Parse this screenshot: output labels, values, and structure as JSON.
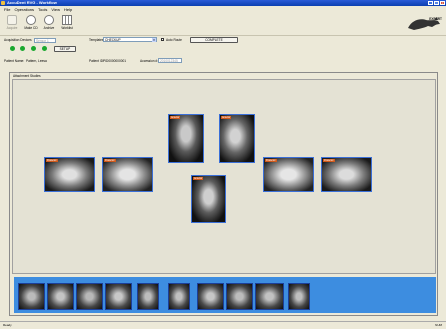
{
  "window": {
    "title": "AccuDent RVG - Workflow"
  },
  "menu": [
    "File",
    "Operations",
    "Tools",
    "View",
    "Help"
  ],
  "toolbar": [
    {
      "label": "Acquire",
      "icon": "scanner-icon",
      "disabled": true
    },
    {
      "label": "Make CD",
      "icon": "cd-icon",
      "disabled": false
    },
    {
      "label": "Archive",
      "icon": "archive-disc-icon",
      "disabled": false
    },
    {
      "label": "Worklist",
      "icon": "grid-icon",
      "disabled": false
    }
  ],
  "brand": {
    "text": "EXPERT"
  },
  "acquisition": {
    "device_label": "Acquisition Devices",
    "device_value": "Sensor 1",
    "template_label": "Templates",
    "template_value": "CHECKUP",
    "autoroute_label": "Auto Route",
    "complete_label": "COMPLETE",
    "setup_label": "SETUP",
    "status_dot_count": 4
  },
  "patient": {
    "name_label": "Patient Name:",
    "name_value": "Pattern, Leesa",
    "id_label": "Patient ID:",
    "id_value": "PID0000000001",
    "accession_label": "Accession #:",
    "accession_value": "2010012345"
  },
  "section_title": "Attachment Studies",
  "statusbar": {
    "left": "Ready",
    "right": "NUM"
  },
  "colors": {
    "accent": "#3d8de0",
    "status_ok": "#1aa82e"
  }
}
